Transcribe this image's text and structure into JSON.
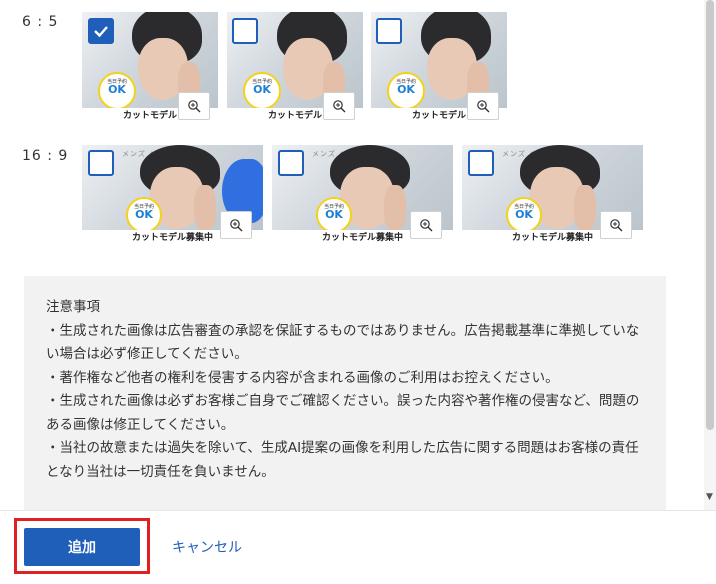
{
  "sections": [
    {
      "ratio": "6 : 5",
      "caption": "カットモデル",
      "badge_top": "当日予約",
      "badge_ok": "OK"
    },
    {
      "ratio": "16 : 9",
      "caption": "カットモデル募集中",
      "badge_top": "当日予約",
      "badge_ok": "OK",
      "top_text": "メンズ ヘア カタログ"
    }
  ],
  "thumbnails_6_5": [
    {
      "checked": true
    },
    {
      "checked": false
    },
    {
      "checked": false
    }
  ],
  "thumbnails_16_9": [
    {
      "checked": false
    },
    {
      "checked": false
    },
    {
      "checked": false
    }
  ],
  "notes": {
    "title": "注意事項",
    "items": [
      "・生成された画像は広告審査の承認を保証するものではありません。広告掲載基準に準拠していない場合は必ず修正してください。",
      "・著作権など他者の権利を侵害する内容が含まれる画像のご利用はお控えください。",
      "・生成された画像は必ずお客様ご自身でご確認ください。誤った内容や著作権の侵害など、問題のある画像は修正してください。",
      "・当社の故意または過失を除いて、生成AI提案の画像を利用した広告に関する問題はお客様の責任となり当社は一切責任を負いません。"
    ]
  },
  "footer": {
    "add_label": "追加",
    "cancel_label": "キャンセル"
  },
  "icons": {
    "zoom": "zoom-in-icon",
    "check": "checkmark-icon"
  }
}
